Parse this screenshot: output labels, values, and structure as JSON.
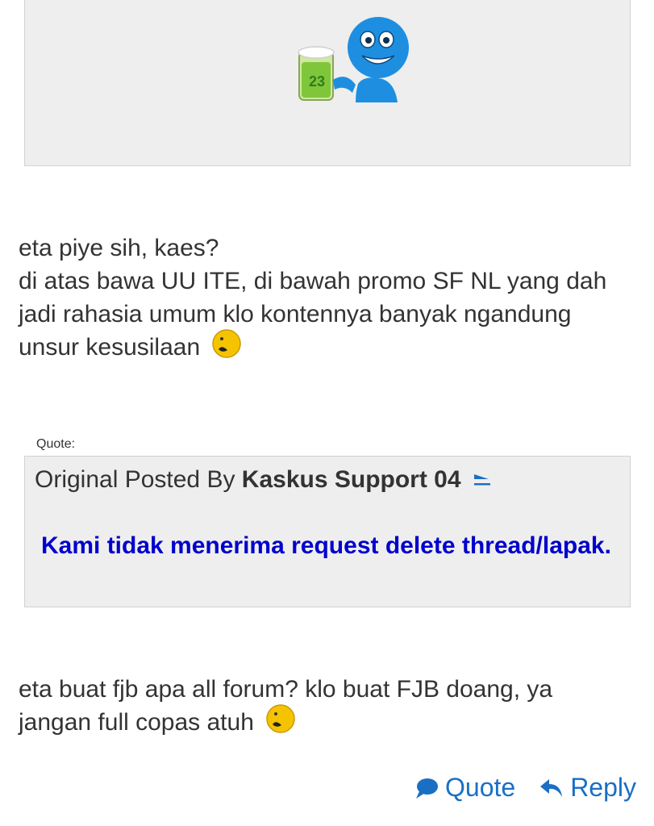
{
  "post1": {
    "lines": [
      "eta piye sih, kaes?",
      "di atas bawa UU ITE, di bawah promo SF NL yang dah",
      "jadi rahasia umum klo kontennya banyak ngandung",
      "unsur kesusilaan"
    ]
  },
  "quote": {
    "label": "Quote:",
    "prefix": "Original Posted By",
    "author": "Kaskus Support 04",
    "body": "Kami tidak menerima request delete thread/lapak."
  },
  "post2": {
    "lines": [
      "eta buat fjb apa all forum? klo buat FJB doang, ya",
      "jangan full copas atuh"
    ]
  },
  "actions": {
    "quote_label": "Quote",
    "reply_label": "Reply"
  },
  "colors": {
    "link": "#1a6fc4",
    "quote_bg": "#eeeeee",
    "quote_body": "#0000cc"
  },
  "icons": {
    "mascot": "beer-mascot-emoticon",
    "smiley": "sweat-smiley-icon",
    "goto": "goto-post-arrow-icon",
    "quote": "speech-bubble-icon",
    "reply": "reply-arrow-icon"
  }
}
